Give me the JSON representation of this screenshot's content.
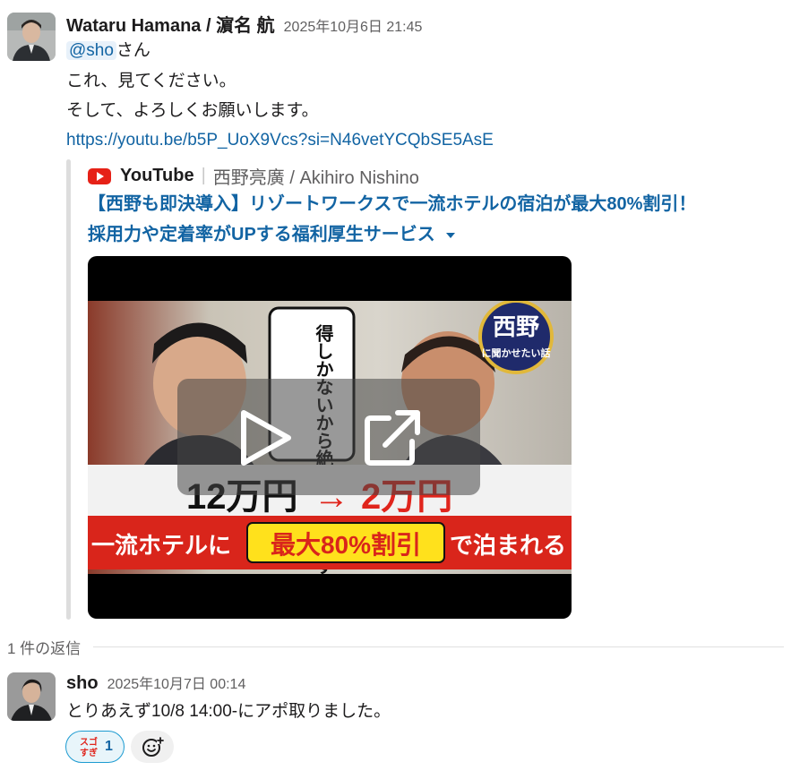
{
  "message1": {
    "author": "Wataru Hamana / 濵名 航",
    "timestamp": "2025年10月6日 21:45",
    "mention": "@sho",
    "mention_suffix": "さん",
    "line2": "これ、見てください。",
    "line3": "そして、よろしくお願いします。",
    "url": "https://youtu.be/b5P_UoX9Vcs?si=N46vetYCQbSE5AsE"
  },
  "unfurl": {
    "source_name": "YouTube",
    "source_author": "西野亮廣 / Akihiro Nishino",
    "title_line1": "【西野も即決導入】リゾートワークスで一流ホテルの宿泊が最大80%割引！",
    "title_line2": "採用力や定着率がUPする福利厚生サービス",
    "thumbnail": {
      "vertical_caption": "得しかないから絶対入会します",
      "logo_text_main": "西野",
      "logo_text_sub": "に聞かせたい話",
      "price_from": "12万円",
      "arrow": "→",
      "price_to": "2万円",
      "banner_left": "一流ホテルに",
      "banner_highlight": "最大80%割引",
      "banner_right": "で泊まれる"
    }
  },
  "thread": {
    "reply_count_label": "1 件の返信"
  },
  "message2": {
    "author": "sho",
    "timestamp": "2025年10月7日 00:14",
    "text": "とりあえず10/8 14:00-にアポ取りました。"
  },
  "reactions": [
    {
      "emoji_text_top": "スゴ",
      "emoji_text_bottom": "すぎ",
      "count": "1"
    }
  ],
  "colors": {
    "link": "#1264a3",
    "mention_bg": "#e8f1fa",
    "youtube_red": "#e62117",
    "reaction_border": "#1d9bd1"
  }
}
